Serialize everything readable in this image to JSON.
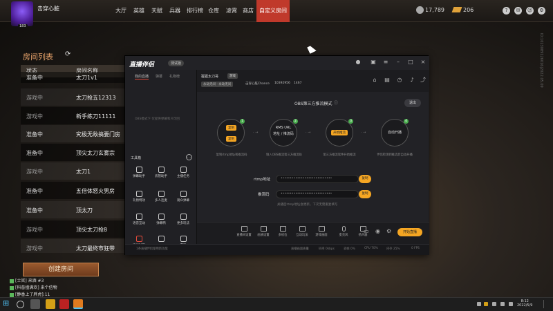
{
  "topbar": {
    "player_name": "击穿心脏",
    "player_level": "183",
    "nav": [
      "大厅",
      "英雄",
      "天赋",
      "兵器",
      "排行榜",
      "仓库",
      "凌霄",
      "商店",
      "自定义房间"
    ],
    "active_nav": "自定义房间",
    "coins": "17,789",
    "gold": "206"
  },
  "room_list": {
    "title": "房间列表",
    "refresh_icon": "refresh-icon",
    "col_status": "状态",
    "col_name": "房间名称",
    "rows": [
      {
        "status": "准备中",
        "name": "太刀1v1"
      },
      {
        "status": "游戏中",
        "name": "太刀抢五12313"
      },
      {
        "status": "游戏中",
        "name": "新手练刀11111"
      },
      {
        "status": "准备中",
        "name": "究极无敌搞要门房"
      },
      {
        "status": "准备中",
        "name": "顶尖太刀玄雾宗"
      },
      {
        "status": "游戏中",
        "name": "太刀1"
      },
      {
        "status": "准备中",
        "name": "五倍体怒火男房"
      },
      {
        "status": "准备中",
        "name": "顶太刀"
      },
      {
        "status": "游戏中",
        "name": "顶尖太刀抢8"
      },
      {
        "status": "游戏中",
        "name": "太刀最终市狂带"
      }
    ],
    "create_button": "创建房间"
  },
  "chat": [
    "[士官] 来酒 #3",
    "[科普撞满欢] 来个信物",
    "[静香上了胖虎]:11"
  ],
  "obs": {
    "logo": "直播伴侣",
    "beta": "测试版",
    "left_tabs": [
      "我的直播",
      "弹幕",
      "礼物榜"
    ],
    "left_message": "OBS模式下 仅提供弹幕和只可回",
    "tools_label": "工具箱",
    "tools": [
      "弹幕助手",
      "房管助手",
      "主播任务",
      "礼物特效",
      "多人连麦",
      "观众弹幕",
      "语音互动",
      "弹幕鸭",
      "更多玩法",
      "高光时刻",
      "",
      "游戏"
    ],
    "stream_title": "猩猩太刀哥",
    "stream_tag": "游戏",
    "category": "永劫无间 · 永劫无间",
    "meta_name": "击穿心脏Chance",
    "meta_id": "10392956",
    "meta_hot": "1467",
    "mode_title": "OBS第三方推流模式",
    "exit_label": "退出",
    "steps": [
      {
        "num": "1",
        "pills": [
          "复制",
          "复制"
        ],
        "text": "",
        "desc": "复制rtmp地址和推流码"
      },
      {
        "num": "2",
        "pills": [],
        "text": "RMS URL\n地址 / 推流码",
        "desc": "填入OBS推流第三方推流处"
      },
      {
        "num": "3",
        "pills": [
          "开始推流"
        ],
        "text": "",
        "desc": "第三方推流软件开始推流"
      },
      {
        "num": "4",
        "pills": [],
        "text": "自动开播",
        "desc": "伴侣检测到推流后自动开播"
      }
    ],
    "rtmp_label": "rtmp地址",
    "rtmp_value": "••••••••••••••••••••••••••••",
    "key_label": "推流码",
    "key_value": "••••••••••••••••••••••••••••",
    "copy_label": "复制",
    "hint": "关播后rtmp地址会更新，下次无需重复填写",
    "bottom_tools": [
      "直播间设置",
      "画质设置",
      "多机位",
      "互动玩法",
      "游戏画面",
      "麦克风",
      "扬声器"
    ],
    "go_live": "开始直播",
    "status_items": [
      "直播画面质量",
      "码率 0kbps",
      "丢帧 0%",
      "CPU 70%",
      "内存 25%",
      "0 FPS"
    ],
    "banner": "1条直播伴侣使用新功能"
  },
  "side_text": "ID:1023089126016|2022.05.09",
  "taskbar": {
    "time": "8:12",
    "date": "2022/5/9"
  }
}
